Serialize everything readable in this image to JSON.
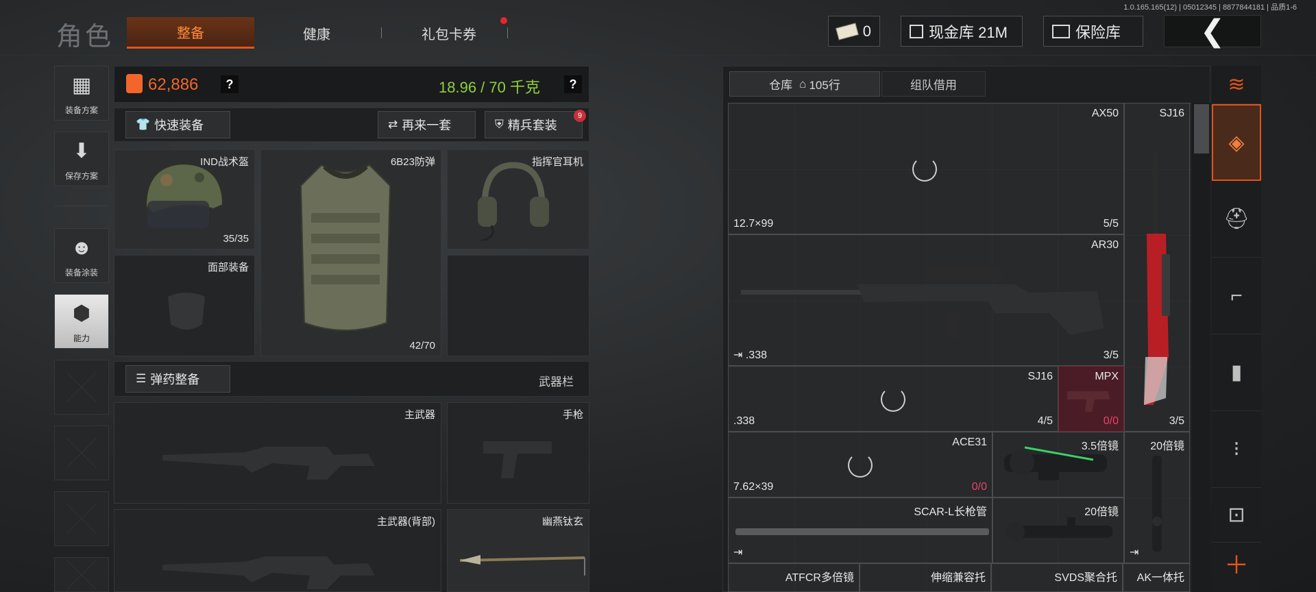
{
  "version_text": "1.0.165.165(12) | 05012345 | 8877844181 | 品质1-6",
  "top": {
    "role_label": "角色",
    "tabs": [
      "整备",
      "健康",
      "礼包卡券"
    ],
    "cash_count": "0",
    "cash_store_label": "现金库 21M",
    "safe_label": "保险库",
    "back_glyph": "❮"
  },
  "left_side": [
    {
      "label": "装备方案",
      "icon": "vest-icon"
    },
    {
      "label": "保存方案",
      "icon": "download-icon"
    },
    {
      "label": "装备涂装",
      "icon": "soldier-icon"
    },
    {
      "label": "能力",
      "icon": "ability-icon"
    }
  ],
  "panel": {
    "total_value": "62,886",
    "weight": "18.96 / 70 千克",
    "help": "?",
    "quick_equip": "快速装备",
    "again": "再来一套",
    "elite": "精兵套装",
    "elite_badge": "9",
    "ammo_equip": "弹药整备",
    "weapon_bar": "武器栏"
  },
  "gear_slots": {
    "helmet": {
      "name": "IND战术盔",
      "count": "35/35"
    },
    "armor": {
      "name": "6B23防弹",
      "count": "42/70"
    },
    "headset": {
      "name": "指挥官耳机"
    },
    "face": {
      "name": "面部装备"
    },
    "primary": {
      "name": "主武器"
    },
    "pistol": {
      "name": "手枪"
    },
    "primary_back": {
      "name": "主武器(背部)"
    },
    "melee": {
      "name": "幽燕钛玄"
    }
  },
  "storage": {
    "tab_storage": "仓库",
    "rows": "105行",
    "tab_team": "组队借用",
    "items": [
      {
        "name": "AX50",
        "count": "5/5",
        "caliber": "12.7×99"
      },
      {
        "name": "SJ16",
        "count": "3/5"
      },
      {
        "name": "AR30",
        "count": "3/5",
        "caliber": ".338"
      },
      {
        "name": "SJ16",
        "count": "4/5",
        "caliber": ".338"
      },
      {
        "name": "MPX",
        "count": "0/0"
      },
      {
        "name": "ACE31",
        "count": "0/0",
        "caliber": "7.62×39"
      },
      {
        "name": "3.5倍镜"
      },
      {
        "name": "20倍镜"
      },
      {
        "name": "SCAR-L长枪管"
      },
      {
        "name": "20倍镜"
      },
      {
        "name": "ATFCR多倍镜"
      },
      {
        "name": "伸缩兼容托"
      },
      {
        "name": "SVDS聚合托"
      },
      {
        "name": "AK一体托"
      }
    ]
  },
  "right_icons": [
    "layers-icon",
    "stack-icon",
    "helmet-icon",
    "rifle-icon",
    "magazine-icon",
    "bullet-icon",
    "sight-icon",
    "plus-icon"
  ],
  "colors": {
    "accent": "#e0551b",
    "value": "#f2662c",
    "weight": "#8fd13a",
    "badge": "#c5303a"
  }
}
